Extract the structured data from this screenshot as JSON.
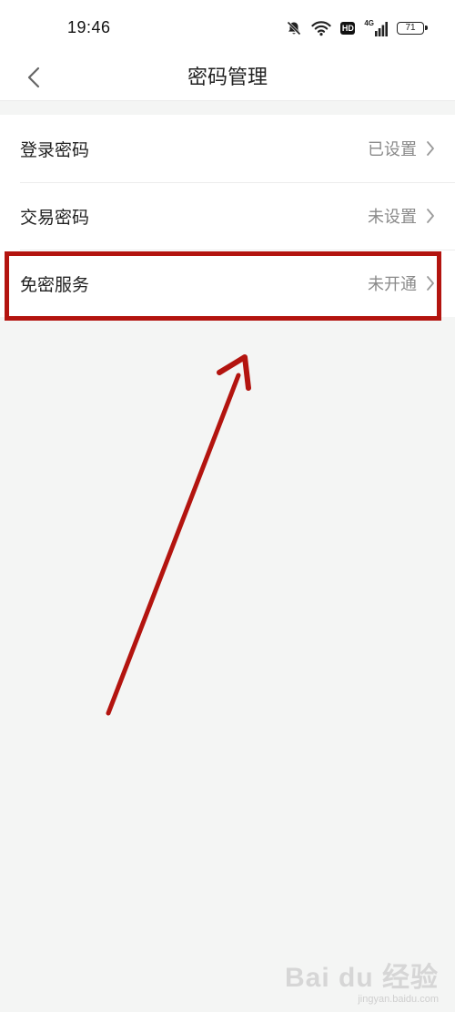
{
  "status_bar": {
    "time": "19:46",
    "hd_label": "HD",
    "network_label": "4G",
    "battery_level": "71",
    "icons": [
      "bell-muted-icon",
      "wifi-icon",
      "hd-icon",
      "signal-4g-icon",
      "battery-icon"
    ]
  },
  "nav": {
    "title": "密码管理",
    "back_icon": "chevron-left-icon"
  },
  "rows": [
    {
      "label": "登录密码",
      "value": "已设置"
    },
    {
      "label": "交易密码",
      "value": "未设置"
    },
    {
      "label": "免密服务",
      "value": "未开通"
    }
  ],
  "annotation": {
    "highlight_color": "#b3140f",
    "highlight_target": "免密服务"
  },
  "watermark": {
    "logo": "Bai du 经验",
    "url": "jingyan.baidu.com"
  }
}
